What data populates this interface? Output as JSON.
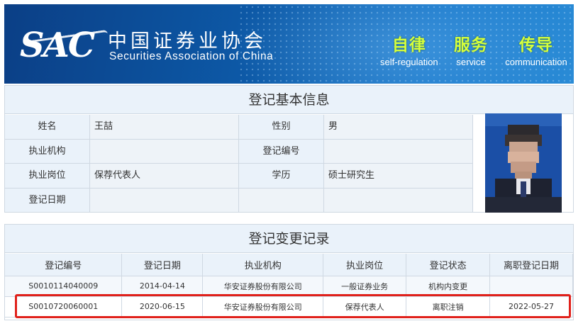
{
  "header": {
    "logo_mark": "SAC",
    "org_name_cn": "中国证券业协会",
    "org_name_en": "Securities Association of China",
    "slogans": [
      {
        "cn": "自律",
        "en": "self-regulation"
      },
      {
        "cn": "服务",
        "en": "service"
      },
      {
        "cn": "传导",
        "en": "communication"
      }
    ]
  },
  "basic_info": {
    "title": "登记基本信息",
    "fields": {
      "name_label": "姓名",
      "name_value": "王喆",
      "gender_label": "性别",
      "gender_value": "男",
      "institution_label": "执业机构",
      "institution_value": "",
      "reg_no_label": "登记编号",
      "reg_no_value": "",
      "position_label": "执业岗位",
      "position_value": "保荐代表人",
      "education_label": "学历",
      "education_value": "硕士研究生",
      "reg_date_label": "登记日期",
      "reg_date_value": ""
    }
  },
  "change_records": {
    "title": "登记变更记录",
    "columns": [
      "登记编号",
      "登记日期",
      "执业机构",
      "执业岗位",
      "登记状态",
      "离职登记日期"
    ],
    "rows": [
      [
        "S0010114040009",
        "2014-04-14",
        "华安证券股份有限公司",
        "一般证券业务",
        "机构内变更",
        ""
      ],
      [
        "S0010720060001",
        "2020-06-15",
        "华安证券股份有限公司",
        "保荐代表人",
        "离职注销",
        "2022-05-27"
      ]
    ]
  },
  "colors": {
    "banner": "#0d5aa8",
    "label_bg": "#eaf2fa",
    "slogan": "#d6ff3c",
    "highlight": "#e0211b"
  }
}
